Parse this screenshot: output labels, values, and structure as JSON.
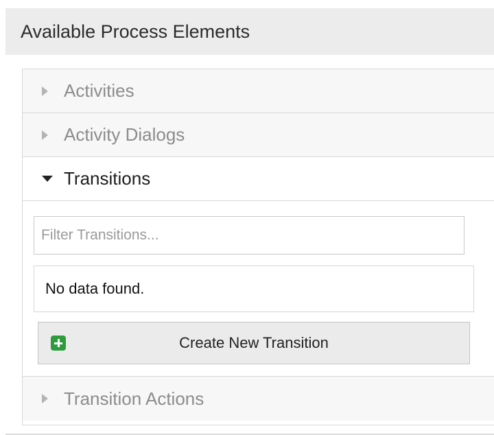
{
  "panel": {
    "title": "Available Process Elements"
  },
  "accordion": {
    "items": [
      {
        "label": "Activities",
        "state": "collapsed"
      },
      {
        "label": "Activity Dialogs",
        "state": "collapsed"
      },
      {
        "label": "Transitions",
        "state": "expanded"
      },
      {
        "label": "Transition Actions",
        "state": "collapsed"
      }
    ]
  },
  "transitions": {
    "filter_placeholder": "Filter Transitions...",
    "empty_message": "No data found.",
    "create_button_label": "Create New Transition"
  },
  "icons": {
    "collapsed": "triangle-right-icon",
    "expanded": "triangle-down-icon",
    "create": "plus-square-icon"
  },
  "colors": {
    "create_icon": "#2e9b3d",
    "header_bg": "#ececec"
  }
}
